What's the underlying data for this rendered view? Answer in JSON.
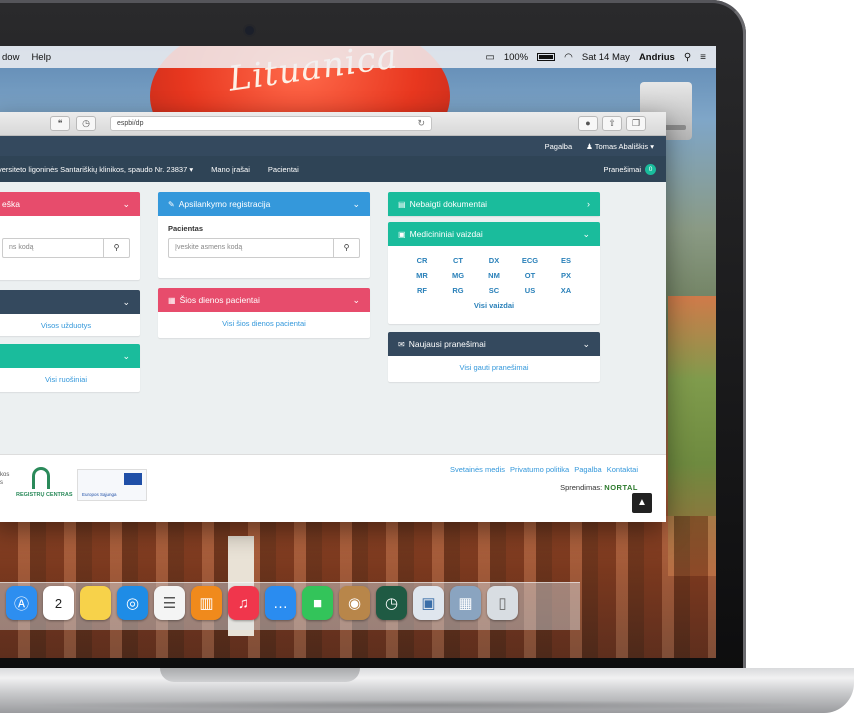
{
  "menubar": {
    "items": [
      "dow",
      "Help"
    ],
    "battery": "100%",
    "datetime": "Sat 14 May",
    "user": "Andrius"
  },
  "wallpaper": {
    "balloon_text": "Lituanica"
  },
  "browser": {
    "address": "espbi/dp"
  },
  "app": {
    "nav_top": {
      "help": "Pagalba",
      "user": "Tomas Abališkis ▾"
    },
    "nav_bottom": {
      "institution": "versiteto ligoninės Santariškių klinikos, spaudo Nr. 23837 ▾",
      "my_records": "Mano įrašai",
      "patients": "Pacientai",
      "messages": "Pranešimai",
      "messages_count": "0"
    },
    "panels": {
      "search": {
        "title": "eška",
        "placeholder": "ns kodą"
      },
      "tasks": {
        "link": "Visos užduotys"
      },
      "drafts": {
        "link": "Visi ruošiniai"
      },
      "registration": {
        "title": "Apsilankymo registracija",
        "label": "Pacientas",
        "placeholder": "Įveskite asmens kodą"
      },
      "today": {
        "title": "Šios dienos pacientai",
        "link": "Visi šios dienos pacientai"
      },
      "unsigned": {
        "title": "Nebaigti dokumentai"
      },
      "images": {
        "title": "Medicininiai vaizdai",
        "modalities": [
          "CR",
          "CT",
          "DX",
          "ECG",
          "ES",
          "MR",
          "MG",
          "NM",
          "OT",
          "PX",
          "RF",
          "RG",
          "SC",
          "US",
          "XA"
        ],
        "all": "Visi vaizdai"
      },
      "messages": {
        "title": "Naujausi pranešimai",
        "link": "Visi gauti pranešimai"
      }
    },
    "footer": {
      "left_text": "kos\ns",
      "registry": "REGISTRŲ CENTRAS",
      "eu_text": "Europos Sąjunga",
      "links": [
        "Svetainės medis",
        "Privatumo politika",
        "Pagalba",
        "Kontaktai"
      ],
      "sponsor_label": "Sprendimas:",
      "sponsor_name": "NORTAL"
    }
  },
  "dock": {
    "icons": [
      "app-store-icon",
      "calendar-icon",
      "notes-icon",
      "safari-icon",
      "reminders-icon",
      "ibooks-icon",
      "itunes-icon",
      "messages-icon",
      "facetime-icon",
      "contacts-icon",
      "time-machine-icon",
      "preview-icon",
      "photos-icon",
      "trash-icon"
    ],
    "calendar_day": "2"
  },
  "colors": {
    "pink": "#e74c6c",
    "blue": "#3498db",
    "navy": "#34495e",
    "teal": "#1abc9c"
  }
}
